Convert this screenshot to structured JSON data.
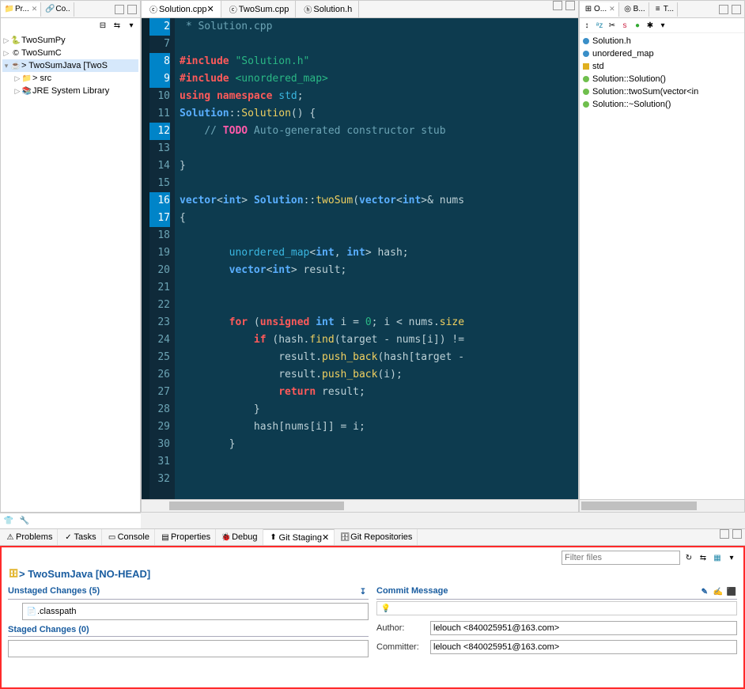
{
  "left_panel": {
    "tabs": [
      {
        "label": "Pr...",
        "active": true
      },
      {
        "label": "Co..",
        "active": false
      }
    ],
    "tree": [
      {
        "label": "TwoSumPy",
        "level": 0,
        "icon": "py"
      },
      {
        "label": "TwoSumC",
        "level": 0,
        "icon": "c"
      },
      {
        "label": "> TwoSumJava [TwoS",
        "level": 0,
        "icon": "java",
        "expanded": true,
        "selected": true
      },
      {
        "label": "> src",
        "level": 1,
        "icon": "folder"
      },
      {
        "label": "JRE System Library",
        "level": 1,
        "icon": "lib"
      }
    ]
  },
  "editor": {
    "tabs": [
      {
        "label": "Solution.cpp",
        "active": true,
        "icon": "c"
      },
      {
        "label": "TwoSum.cpp",
        "active": false,
        "icon": "c"
      },
      {
        "label": "Solution.h",
        "active": false,
        "icon": "h"
      }
    ],
    "first_line": 2,
    "lines": [
      {
        "n": 2,
        "html": " <span class='cmt'>* Solution.cpp</span>"
      },
      {
        "n": 7,
        "html": ""
      },
      {
        "n": 8,
        "html": "<span class='kw'>#include</span> <span class='str'>\"Solution.h\"</span>"
      },
      {
        "n": 9,
        "html": "<span class='kw'>#include</span> <span class='str'>&lt;unordered_map&gt;</span>"
      },
      {
        "n": 10,
        "html": "<span class='kw'>using</span> <span class='kw'>namespace</span> <span class='id'>std</span>;"
      },
      {
        "n": 11,
        "html": "<span class='type'>Solution</span>::<span class='fn'>Solution</span>() {"
      },
      {
        "n": 12,
        "html": "    <span class='cmt'>// <span class='todo'>TODO</span> Auto-generated constructor stub</span>"
      },
      {
        "n": 13,
        "html": ""
      },
      {
        "n": 14,
        "html": "}"
      },
      {
        "n": 15,
        "html": ""
      },
      {
        "n": 16,
        "html": "<span class='type'>vector</span>&lt;<span class='type'>int</span>&gt; <span class='type'>Solution</span>::<span class='fn'>twoSum</span>(<span class='type'>vector</span>&lt;<span class='type'>int</span>&gt;&amp; nums"
      },
      {
        "n": 17,
        "html": "{"
      },
      {
        "n": 18,
        "html": ""
      },
      {
        "n": 19,
        "html": "        <span class='id'>unordered_map</span>&lt;<span class='type'>int</span>, <span class='type'>int</span>&gt; hash;"
      },
      {
        "n": 20,
        "html": "        <span class='type'>vector</span>&lt;<span class='type'>int</span>&gt; result;"
      },
      {
        "n": 21,
        "html": ""
      },
      {
        "n": 22,
        "html": ""
      },
      {
        "n": 23,
        "html": "        <span class='kw'>for</span> (<span class='kw'>unsigned</span> <span class='type'>int</span> i = <span class='str'>0</span>; i &lt; nums.<span class='fn'>size</span>"
      },
      {
        "n": 24,
        "html": "            <span class='kw'>if</span> (hash.<span class='fn'>find</span>(target - nums[i]) !="
      },
      {
        "n": 25,
        "html": "                result.<span class='fn'>push_back</span>(hash[target -"
      },
      {
        "n": 26,
        "html": "                result.<span class='fn'>push_back</span>(i);"
      },
      {
        "n": 27,
        "html": "                <span class='kw'>return</span> result;"
      },
      {
        "n": 28,
        "html": "            }"
      },
      {
        "n": 29,
        "html": "            hash[nums[i]] = i;"
      },
      {
        "n": 30,
        "html": "        }"
      },
      {
        "n": 31,
        "html": ""
      },
      {
        "n": 32,
        "html": ""
      }
    ]
  },
  "outline": {
    "tabs": [
      {
        "label": "O...",
        "active": true
      },
      {
        "label": "B...",
        "active": false
      },
      {
        "label": "T...",
        "active": false
      }
    ],
    "items": [
      {
        "label": "Solution.h",
        "kind": "file"
      },
      {
        "label": "unordered_map",
        "kind": "file"
      },
      {
        "label": "std",
        "kind": "ns"
      },
      {
        "label": "Solution::Solution()",
        "kind": "method"
      },
      {
        "label": "Solution::twoSum(vector<in",
        "kind": "method"
      },
      {
        "label": "Solution::~Solution()",
        "kind": "method"
      }
    ]
  },
  "bottom": {
    "tabs": [
      {
        "label": "Problems"
      },
      {
        "label": "Tasks"
      },
      {
        "label": "Console"
      },
      {
        "label": "Properties"
      },
      {
        "label": "Debug"
      },
      {
        "label": "Git Staging",
        "active": true
      },
      {
        "label": "Git Repositories"
      }
    ],
    "filter_placeholder": "Filter files",
    "repo_title": "> TwoSumJava [NO-HEAD]",
    "unstaged_header": "Unstaged Changes (5)",
    "unstaged_item": ".classpath",
    "staged_header": "Staged Changes (0)",
    "commit_header": "Commit Message",
    "author_label": "Author:",
    "author_value": "lelouch <840025951@163.com>",
    "committer_label": "Committer:",
    "committer_value": "lelouch <840025951@163.com>"
  }
}
